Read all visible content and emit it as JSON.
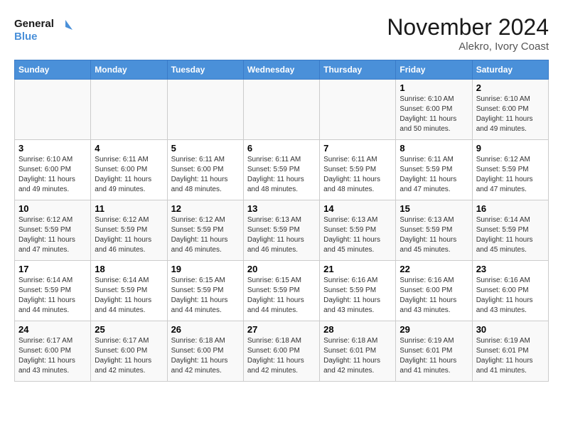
{
  "header": {
    "logo_line1": "General",
    "logo_line2": "Blue",
    "month": "November 2024",
    "location": "Alekro, Ivory Coast"
  },
  "weekdays": [
    "Sunday",
    "Monday",
    "Tuesday",
    "Wednesday",
    "Thursday",
    "Friday",
    "Saturday"
  ],
  "weeks": [
    [
      {
        "day": "",
        "info": ""
      },
      {
        "day": "",
        "info": ""
      },
      {
        "day": "",
        "info": ""
      },
      {
        "day": "",
        "info": ""
      },
      {
        "day": "",
        "info": ""
      },
      {
        "day": "1",
        "info": "Sunrise: 6:10 AM\nSunset: 6:00 PM\nDaylight: 11 hours\nand 50 minutes."
      },
      {
        "day": "2",
        "info": "Sunrise: 6:10 AM\nSunset: 6:00 PM\nDaylight: 11 hours\nand 49 minutes."
      }
    ],
    [
      {
        "day": "3",
        "info": "Sunrise: 6:10 AM\nSunset: 6:00 PM\nDaylight: 11 hours\nand 49 minutes."
      },
      {
        "day": "4",
        "info": "Sunrise: 6:11 AM\nSunset: 6:00 PM\nDaylight: 11 hours\nand 49 minutes."
      },
      {
        "day": "5",
        "info": "Sunrise: 6:11 AM\nSunset: 6:00 PM\nDaylight: 11 hours\nand 48 minutes."
      },
      {
        "day": "6",
        "info": "Sunrise: 6:11 AM\nSunset: 5:59 PM\nDaylight: 11 hours\nand 48 minutes."
      },
      {
        "day": "7",
        "info": "Sunrise: 6:11 AM\nSunset: 5:59 PM\nDaylight: 11 hours\nand 48 minutes."
      },
      {
        "day": "8",
        "info": "Sunrise: 6:11 AM\nSunset: 5:59 PM\nDaylight: 11 hours\nand 47 minutes."
      },
      {
        "day": "9",
        "info": "Sunrise: 6:12 AM\nSunset: 5:59 PM\nDaylight: 11 hours\nand 47 minutes."
      }
    ],
    [
      {
        "day": "10",
        "info": "Sunrise: 6:12 AM\nSunset: 5:59 PM\nDaylight: 11 hours\nand 47 minutes."
      },
      {
        "day": "11",
        "info": "Sunrise: 6:12 AM\nSunset: 5:59 PM\nDaylight: 11 hours\nand 46 minutes."
      },
      {
        "day": "12",
        "info": "Sunrise: 6:12 AM\nSunset: 5:59 PM\nDaylight: 11 hours\nand 46 minutes."
      },
      {
        "day": "13",
        "info": "Sunrise: 6:13 AM\nSunset: 5:59 PM\nDaylight: 11 hours\nand 46 minutes."
      },
      {
        "day": "14",
        "info": "Sunrise: 6:13 AM\nSunset: 5:59 PM\nDaylight: 11 hours\nand 45 minutes."
      },
      {
        "day": "15",
        "info": "Sunrise: 6:13 AM\nSunset: 5:59 PM\nDaylight: 11 hours\nand 45 minutes."
      },
      {
        "day": "16",
        "info": "Sunrise: 6:14 AM\nSunset: 5:59 PM\nDaylight: 11 hours\nand 45 minutes."
      }
    ],
    [
      {
        "day": "17",
        "info": "Sunrise: 6:14 AM\nSunset: 5:59 PM\nDaylight: 11 hours\nand 44 minutes."
      },
      {
        "day": "18",
        "info": "Sunrise: 6:14 AM\nSunset: 5:59 PM\nDaylight: 11 hours\nand 44 minutes."
      },
      {
        "day": "19",
        "info": "Sunrise: 6:15 AM\nSunset: 5:59 PM\nDaylight: 11 hours\nand 44 minutes."
      },
      {
        "day": "20",
        "info": "Sunrise: 6:15 AM\nSunset: 5:59 PM\nDaylight: 11 hours\nand 44 minutes."
      },
      {
        "day": "21",
        "info": "Sunrise: 6:16 AM\nSunset: 5:59 PM\nDaylight: 11 hours\nand 43 minutes."
      },
      {
        "day": "22",
        "info": "Sunrise: 6:16 AM\nSunset: 6:00 PM\nDaylight: 11 hours\nand 43 minutes."
      },
      {
        "day": "23",
        "info": "Sunrise: 6:16 AM\nSunset: 6:00 PM\nDaylight: 11 hours\nand 43 minutes."
      }
    ],
    [
      {
        "day": "24",
        "info": "Sunrise: 6:17 AM\nSunset: 6:00 PM\nDaylight: 11 hours\nand 43 minutes."
      },
      {
        "day": "25",
        "info": "Sunrise: 6:17 AM\nSunset: 6:00 PM\nDaylight: 11 hours\nand 42 minutes."
      },
      {
        "day": "26",
        "info": "Sunrise: 6:18 AM\nSunset: 6:00 PM\nDaylight: 11 hours\nand 42 minutes."
      },
      {
        "day": "27",
        "info": "Sunrise: 6:18 AM\nSunset: 6:00 PM\nDaylight: 11 hours\nand 42 minutes."
      },
      {
        "day": "28",
        "info": "Sunrise: 6:18 AM\nSunset: 6:01 PM\nDaylight: 11 hours\nand 42 minutes."
      },
      {
        "day": "29",
        "info": "Sunrise: 6:19 AM\nSunset: 6:01 PM\nDaylight: 11 hours\nand 41 minutes."
      },
      {
        "day": "30",
        "info": "Sunrise: 6:19 AM\nSunset: 6:01 PM\nDaylight: 11 hours\nand 41 minutes."
      }
    ]
  ]
}
